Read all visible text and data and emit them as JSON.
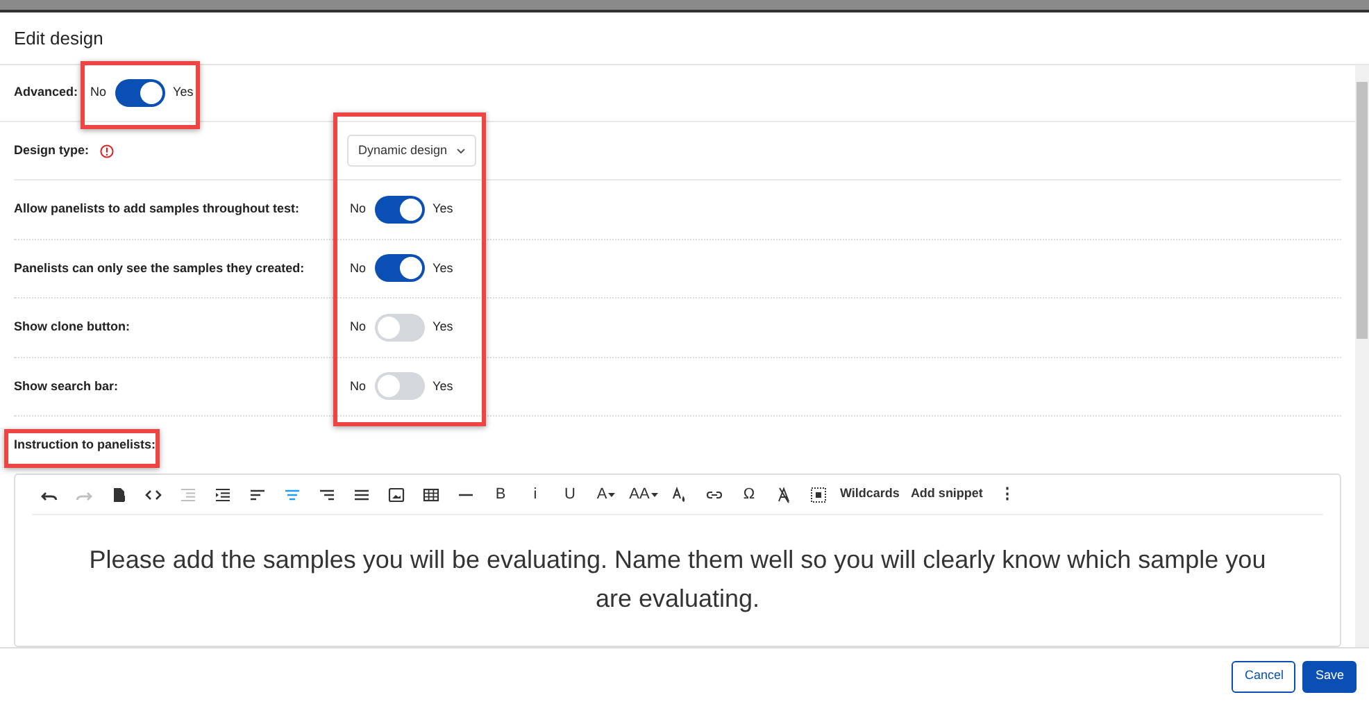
{
  "dialog": {
    "title": "Edit design"
  },
  "advanced": {
    "label": "Advanced:",
    "off_label": "No",
    "on_label": "Yes",
    "on": true
  },
  "design_type": {
    "label": "Design type:",
    "value": "Dynamic design"
  },
  "settings": [
    {
      "label": "Allow panelists to add samples throughout test:",
      "off_label": "No",
      "on_label": "Yes",
      "on": true
    },
    {
      "label": "Panelists can only see the samples they created:",
      "off_label": "No",
      "on_label": "Yes",
      "on": true
    },
    {
      "label": "Show clone button:",
      "off_label": "No",
      "on_label": "Yes",
      "on": false
    },
    {
      "label": "Show search bar:",
      "off_label": "No",
      "on_label": "Yes",
      "on": false
    }
  ],
  "instruction": {
    "label": "Instruction to panelists:",
    "toolbar": [
      {
        "kind": "undo",
        "disabled": false,
        "selected": false
      },
      {
        "kind": "redo",
        "disabled": true,
        "selected": false
      },
      {
        "kind": "file",
        "disabled": false,
        "selected": false
      },
      {
        "kind": "code",
        "disabled": false,
        "selected": false
      },
      {
        "kind": "outdent",
        "disabled": true,
        "selected": false
      },
      {
        "kind": "indent",
        "disabled": false,
        "selected": false
      },
      {
        "kind": "align-left",
        "disabled": false,
        "selected": false
      },
      {
        "kind": "align-center",
        "disabled": false,
        "selected": true
      },
      {
        "kind": "align-right",
        "disabled": false,
        "selected": false
      },
      {
        "kind": "justify",
        "disabled": false,
        "selected": false
      },
      {
        "kind": "image",
        "disabled": false,
        "selected": false
      },
      {
        "kind": "table",
        "disabled": false,
        "selected": false
      },
      {
        "kind": "rule",
        "disabled": false,
        "selected": false
      },
      {
        "kind": "glyph",
        "label": "B",
        "disabled": false,
        "selected": false
      },
      {
        "kind": "glyph",
        "label": "i",
        "disabled": false,
        "selected": false
      },
      {
        "kind": "glyph",
        "label": "U",
        "disabled": false,
        "selected": false
      },
      {
        "kind": "dropdown",
        "label": "A",
        "disabled": false,
        "selected": false
      },
      {
        "kind": "dropdown",
        "label": "AA",
        "disabled": false,
        "selected": false
      },
      {
        "kind": "fill",
        "disabled": false,
        "selected": false
      },
      {
        "kind": "link",
        "disabled": false,
        "selected": false
      },
      {
        "kind": "glyph",
        "label": "Ω",
        "disabled": false,
        "selected": false
      },
      {
        "kind": "clear",
        "disabled": false,
        "selected": false
      },
      {
        "kind": "select-all",
        "disabled": false,
        "selected": false
      },
      {
        "kind": "text",
        "label": "Wildcards",
        "disabled": false,
        "selected": false
      },
      {
        "kind": "text",
        "label": "Add snippet",
        "disabled": false,
        "selected": false
      },
      {
        "kind": "glyph",
        "label": "⋮",
        "disabled": false,
        "selected": false
      }
    ],
    "text": "Please add the samples you will be evaluating. Name them well so you will clearly know which sample you are evaluating."
  },
  "buttons": [
    {
      "kind": "secondary",
      "label": "Cancel"
    },
    {
      "kind": "primary",
      "label": "Save"
    }
  ]
}
